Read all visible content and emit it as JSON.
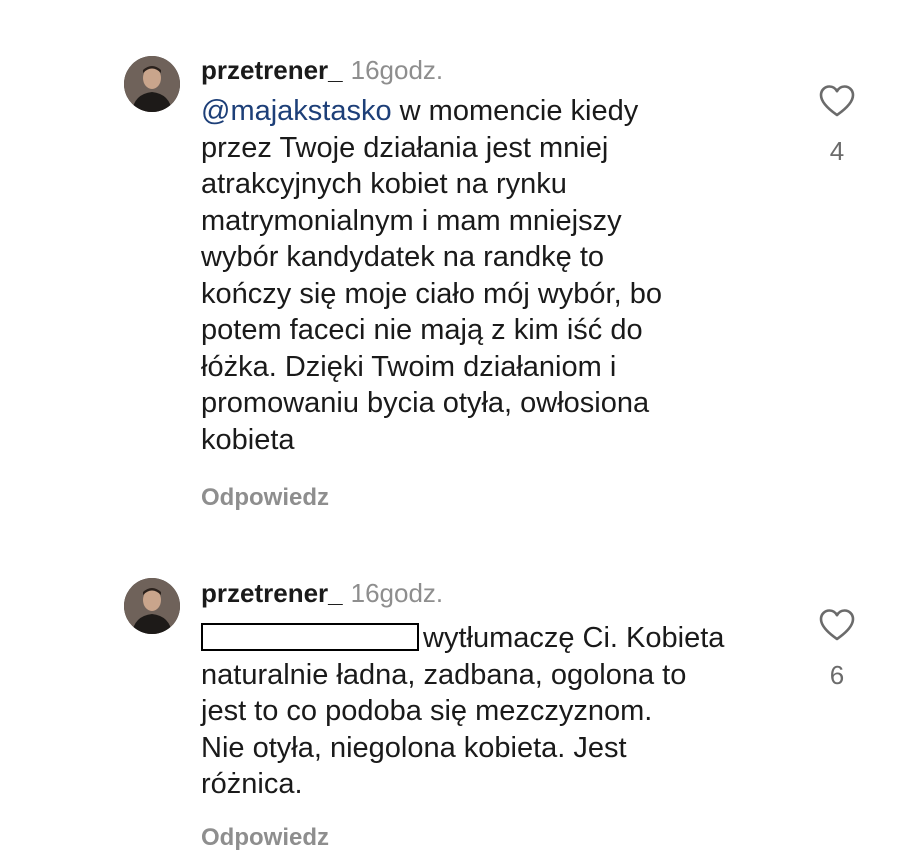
{
  "comments": [
    {
      "username": "przetrener_",
      "time": "16godz.",
      "mention": "@majakstasko",
      "lines": [
        " w momencie kiedy",
        "przez Twoje działania jest mniej",
        "atrakcyjnych kobiet na rynku",
        "matrymonialnym i mam mniejszy",
        "wybór kandydatek na randkę to",
        "kończy się moje ciało mój wybór, bo",
        "potem faceci nie mają z kim iść do",
        "łóżka. Dzięki Twoim działaniom i",
        "promowaniu bycia otyła, owłosiona",
        "kobieta"
      ],
      "reply_label": "Odpowiedz",
      "like_count": "4",
      "like_icon": "heart-outline-icon"
    },
    {
      "username": "przetrener_",
      "time": "16godz.",
      "mention_redacted": true,
      "lines": [
        "wytłumaczę Ci. Kobieta",
        "naturalnie ładna, zadbana, ogolona to",
        "jest to co podoba się mezczyznom.",
        "Nie otyła, niegolona kobieta. Jest",
        "różnica."
      ],
      "reply_label": "Odpowiedz",
      "like_count": "6",
      "like_icon": "heart-outline-icon"
    }
  ],
  "colors": {
    "mention": "#1d3f78",
    "secondary_text": "#8e8e8e",
    "primary_text": "#1a1a1a"
  }
}
